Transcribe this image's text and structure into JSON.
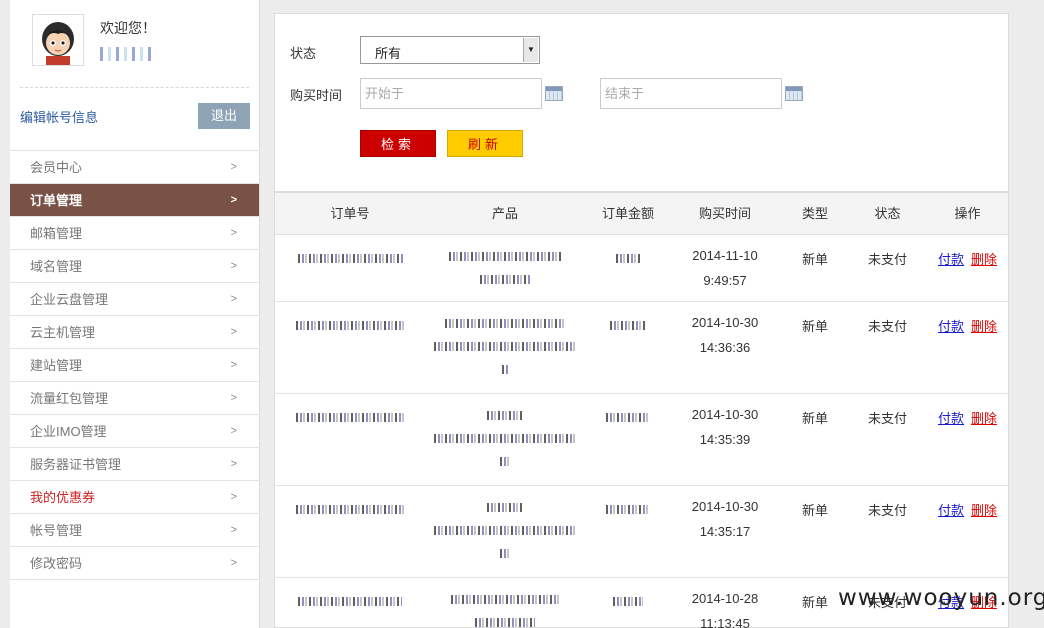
{
  "user": {
    "welcome": "欢迎您！",
    "edit_account": "编辑帐号信息",
    "logout": "退出"
  },
  "menu": [
    {
      "label": "会员中心",
      "arrow": ">",
      "state": "normal"
    },
    {
      "label": "订单管理",
      "arrow": ">",
      "state": "active"
    },
    {
      "label": "邮箱管理",
      "arrow": ">",
      "state": "normal"
    },
    {
      "label": "域名管理",
      "arrow": ">",
      "state": "normal"
    },
    {
      "label": "企业云盘管理",
      "arrow": ">",
      "state": "normal"
    },
    {
      "label": "云主机管理",
      "arrow": ">",
      "state": "normal"
    },
    {
      "label": "建站管理",
      "arrow": ">",
      "state": "normal"
    },
    {
      "label": "流量红包管理",
      "arrow": ">",
      "state": "normal"
    },
    {
      "label": "企业IMO管理",
      "arrow": ">",
      "state": "normal"
    },
    {
      "label": "服务器证书管理",
      "arrow": ">",
      "state": "normal"
    },
    {
      "label": "我的优惠券",
      "arrow": ">",
      "state": "highlight"
    },
    {
      "label": "帐号管理",
      "arrow": ">",
      "state": "normal"
    },
    {
      "label": "修改密码",
      "arrow": ">",
      "state": "normal"
    }
  ],
  "filter": {
    "status_label": "状态",
    "status_value": "所有",
    "date_label": "购买时间",
    "start_placeholder": "开始于",
    "end_placeholder": "结束于",
    "search_button": "检索",
    "refresh_button": "刷新"
  },
  "table": {
    "headers": [
      "订单号",
      "产品",
      "订单金额",
      "购买时间",
      "类型",
      "状态",
      "操作"
    ],
    "rows": [
      {
        "date": "2014-11-10",
        "time": "9:49:57",
        "type": "新单",
        "status": "未支付",
        "pay": "付款",
        "delete": "删除"
      },
      {
        "date": "2014-10-30",
        "time": "14:36:36",
        "type": "新单",
        "status": "未支付",
        "pay": "付款",
        "delete": "删除"
      },
      {
        "date": "2014-10-30",
        "time": "14:35:39",
        "type": "新单",
        "status": "未支付",
        "pay": "付款",
        "delete": "删除"
      },
      {
        "date": "2014-10-30",
        "time": "14:35:17",
        "type": "新单",
        "status": "未支付",
        "pay": "付款",
        "delete": "删除"
      },
      {
        "date": "2014-10-28",
        "time": "11:13:45",
        "type": "新单",
        "status": "未支付",
        "pay": "付款",
        "delete": "删除"
      }
    ]
  },
  "watermark": "www.wooyun.org",
  "colors": {
    "active_menu": "#7a5147",
    "search_button": "#cc0000",
    "refresh_button": "#ffcc00",
    "logout_button": "#8ea3b5",
    "link": "#1a1acc",
    "delete_link": "#dd0000"
  }
}
